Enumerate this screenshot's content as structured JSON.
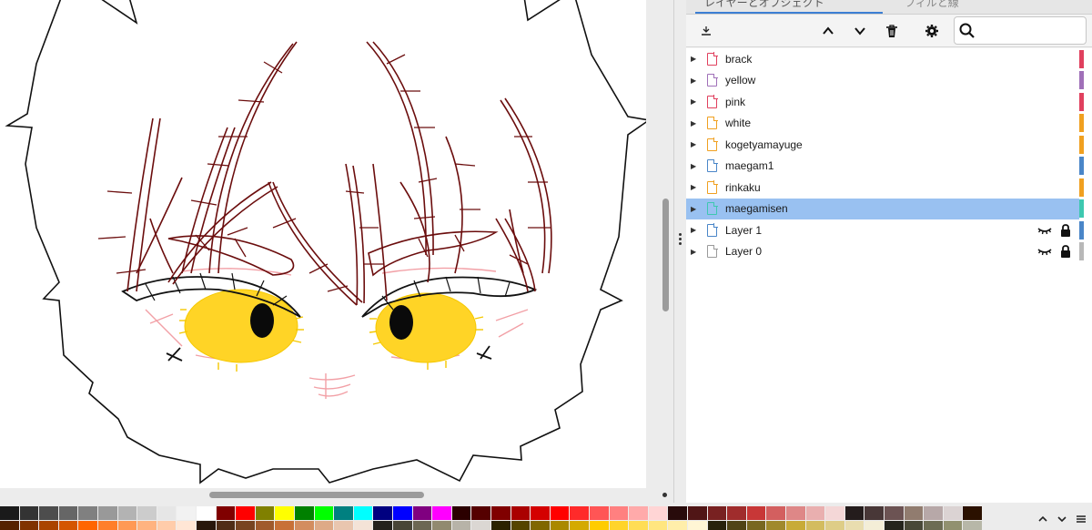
{
  "panel": {
    "tabs": [
      {
        "label": "レイヤーとオブジェクト"
      },
      {
        "label": "フィルと線"
      }
    ],
    "toolbar": {
      "add_layer_icon": "new-layer-icon",
      "move_up_icon": "chevron-up-icon",
      "move_down_icon": "chevron-down-icon",
      "delete_icon": "trash-icon",
      "settings_icon": "gear-icon",
      "search_icon": "search-icon",
      "search_value": ""
    },
    "layers": [
      {
        "name": "brack",
        "icon_color": "#e0405e",
        "tag_color": "#e0405e",
        "selected": false,
        "show_controls": false
      },
      {
        "name": "yellow",
        "icon_color": "#a070b8",
        "tag_color": "#a070b8",
        "selected": false,
        "show_controls": false
      },
      {
        "name": "pink",
        "icon_color": "#e0405e",
        "tag_color": "#e0405e",
        "selected": false,
        "show_controls": false
      },
      {
        "name": "white",
        "icon_color": "#f0a020",
        "tag_color": "#f0a020",
        "selected": false,
        "show_controls": false
      },
      {
        "name": "kogetyamayuge",
        "icon_color": "#f0a020",
        "tag_color": "#f0a020",
        "selected": false,
        "show_controls": false
      },
      {
        "name": "maegam1",
        "icon_color": "#4a86c8",
        "tag_color": "#4a86c8",
        "selected": false,
        "show_controls": false
      },
      {
        "name": "rinkaku",
        "icon_color": "#f0a020",
        "tag_color": "#f0a020",
        "selected": false,
        "show_controls": false
      },
      {
        "name": "maegamisen",
        "icon_color": "#3ec8b0",
        "tag_color": "#3ec8b0",
        "selected": true,
        "show_controls": false
      },
      {
        "name": "Layer 1",
        "icon_color": "#4a86c8",
        "tag_color": "#4a86c8",
        "selected": false,
        "show_controls": true
      },
      {
        "name": "Layer 0",
        "icon_color": "#9a9a9a",
        "tag_color": "#b8b8b8",
        "selected": false,
        "show_controls": true
      }
    ]
  },
  "palette": {
    "colors": [
      "#1a1a1a",
      "#333333",
      "#4d4d4d",
      "#666666",
      "#808080",
      "#999999",
      "#b3b3b3",
      "#cccccc",
      "#e6e6e6",
      "#f2f2f2",
      "#ffffff",
      "#800000",
      "#ff0000",
      "#808000",
      "#ffff00",
      "#008000",
      "#00ff00",
      "#008080",
      "#00ffff",
      "#000080",
      "#0000ff",
      "#800080",
      "#ff00ff",
      "#2b0000",
      "#550000",
      "#800000",
      "#aa0000",
      "#d40000",
      "#ff0000",
      "#ff2a2a",
      "#ff5555",
      "#ff8080",
      "#ffaaaa",
      "#ffd5d5",
      "#280b0b",
      "#501616",
      "#782121",
      "#a02c2c",
      "#c83737",
      "#d35f5f",
      "#de8787",
      "#e9afaf",
      "#f4d7d7",
      "#241c1c",
      "#483737",
      "#6c5353",
      "#917c6f",
      "#b7a8a8",
      "#dbd3d3",
      "#2b1100"
    ],
    "colors2": [
      "#552200",
      "#803300",
      "#aa4400",
      "#d45500",
      "#ff6600",
      "#ff7f2a",
      "#ff9955",
      "#ffb380",
      "#ffccaa",
      "#ffe6d5",
      "#28170b",
      "#502d16",
      "#784421",
      "#a05a2c",
      "#c87137",
      "#d38d5f",
      "#deaa87",
      "#e9c6af",
      "#f4e3d7",
      "#24221c",
      "#484537",
      "#6c6753",
      "#918a6f",
      "#b7b3a8",
      "#dbd7d3",
      "#2b2200",
      "#554400",
      "#806600",
      "#aa8800",
      "#d4aa00",
      "#ffcc00",
      "#ffd42a",
      "#ffdd55",
      "#ffe680",
      "#ffeeaa",
      "#fff6d5",
      "#28220b",
      "#504416",
      "#786721",
      "#a0892c",
      "#c8ab37",
      "#d3bc5f",
      "#decd87",
      "#e9ddaf",
      "#f4eed7",
      "#24241c",
      "#484837",
      "#6c6c53",
      "#91916f",
      "#b7b7a8"
    ],
    "scroll_up_icon": "chevron-up-icon",
    "scroll_down_icon": "chevron-down-icon",
    "menu_icon": "menu-icon"
  }
}
